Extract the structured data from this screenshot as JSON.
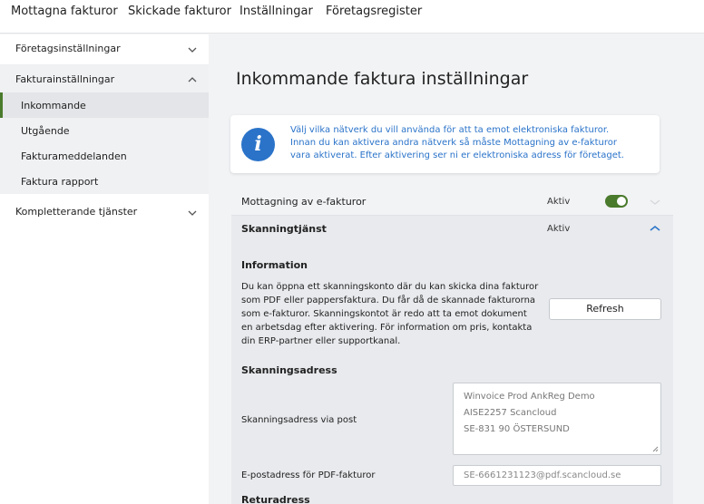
{
  "topnav": {
    "tabs": [
      {
        "label": "Mottagna fakturor"
      },
      {
        "label": "Skickade fakturor"
      },
      {
        "label": "Inställningar"
      },
      {
        "label": "Företagsregister"
      }
    ]
  },
  "sidebar": {
    "sections": [
      {
        "label": "Företagsinställningar",
        "expanded": false,
        "icon": "chevron-down-icon"
      },
      {
        "label": "Fakturainställningar",
        "expanded": true,
        "icon": "chevron-up-icon"
      },
      {
        "label": "Kompletterande tjänster",
        "expanded": false,
        "icon": "chevron-down-icon"
      }
    ],
    "subitems": [
      {
        "label": "Inkommande",
        "active": true
      },
      {
        "label": "Utgående",
        "active": false
      },
      {
        "label": "Fakturameddelanden",
        "active": false
      },
      {
        "label": "Faktura rapport",
        "active": false
      }
    ]
  },
  "main": {
    "title": "Inkommande faktura inställningar",
    "info": {
      "icon": "info-icon",
      "lines": [
        "Välj vilka nätverk du vill använda för att ta emot elektroniska fakturor.",
        "Innan du kan aktivera andra nätverk så måste Mottagning av e-fakturor",
        "vara aktiverat. Efter aktivering ser ni er elektroniska adress för företaget."
      ]
    },
    "mottagning": {
      "label": "Mottagning av e-fakturor",
      "status": "Aktiv",
      "enabled": true
    },
    "skanning": {
      "label": "Skanningtjänst",
      "status": "Aktiv",
      "information_title": "Information",
      "paragraph": [
        "Du kan öppna ett skanningskonto där du kan skicka dina fakturor",
        "som PDF eller pappersfaktura. Du får då de skannade fakturorna",
        "som e-fakturor. Skanningskontot är redo att ta emot dokument",
        "en arbetsdag efter aktivering. För information om pris, kontakta",
        "din ERP-partner eller supportkanal."
      ],
      "refresh_label": "Refresh",
      "address_title": "Skanningsadress",
      "post_label": "Skanningsadress via post",
      "post_lines": [
        "Winvoice Prod AnkReg Demo",
        "AISE2257 Scancloud",
        "SE-831 90 ÖSTERSUND"
      ],
      "email_label": "E-postadress för PDF-fakturor",
      "email_value": "SE-6661231123@pdf.scancloud.se",
      "return_title": "Returadress"
    }
  },
  "colors": {
    "accent_green": "#4a7a2c",
    "info_blue": "#2a73c9",
    "panel_gray": "#e8eaed"
  }
}
